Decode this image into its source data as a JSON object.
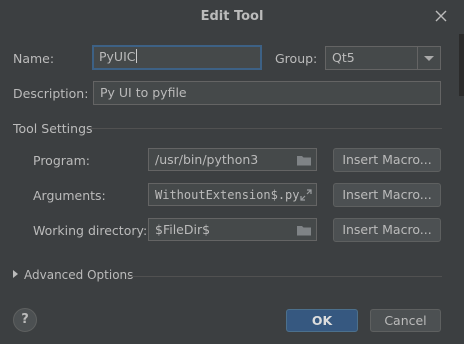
{
  "dialog": {
    "title": "Edit Tool"
  },
  "name": {
    "label": "Name:",
    "value": "PyUIC"
  },
  "group": {
    "label": "Group:",
    "selected": "Qt5"
  },
  "description": {
    "label": "Description:",
    "value": "Py UI to pyfile"
  },
  "tool_settings": {
    "title": "Tool Settings",
    "program": {
      "label": "Program:",
      "value": "/usr/bin/python3",
      "button": "Insert Macro..."
    },
    "arguments": {
      "label": "Arguments:",
      "value": "WithoutExtension$.py",
      "button": "Insert Macro..."
    },
    "working_directory": {
      "label": "Working directory:",
      "value": "$FileDir$",
      "button": "Insert Macro..."
    }
  },
  "advanced": {
    "label": "Advanced Options"
  },
  "footer": {
    "help": "?",
    "ok": "OK",
    "cancel": "Cancel"
  },
  "colors": {
    "background": "#3c3f41",
    "primary_button": "#365880",
    "focus_border": "#3d6185"
  },
  "icons": [
    "close-icon",
    "chevron-down-icon",
    "folder-icon",
    "expand-icon",
    "chevron-right-icon"
  ]
}
